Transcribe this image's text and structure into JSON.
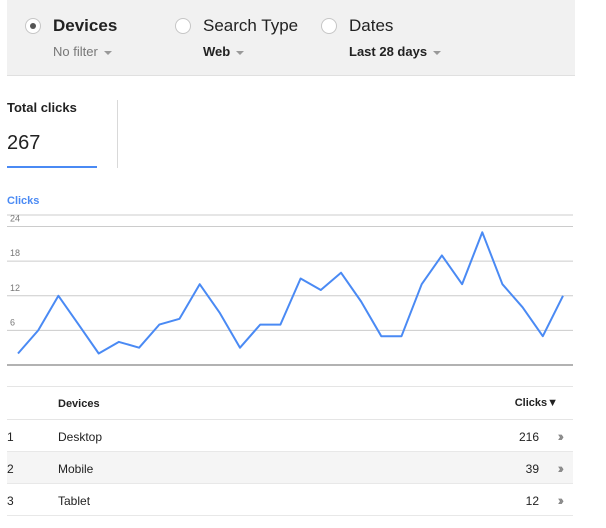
{
  "filters": [
    {
      "label": "Devices",
      "value": "No filter",
      "selected": true
    },
    {
      "label": "Search Type",
      "value": "Web",
      "selected": false
    },
    {
      "label": "Dates",
      "value": "Last 28 days",
      "selected": false
    }
  ],
  "metric": {
    "label": "Total clicks",
    "value": "267"
  },
  "chart_data": {
    "type": "line",
    "title": "Clicks",
    "xlabel": "",
    "ylabel": "",
    "ylim": [
      0,
      26
    ],
    "yticks": [
      "6",
      "12",
      "18",
      "24"
    ],
    "grid": true,
    "series": [
      {
        "values": [
          2,
          6,
          12,
          7,
          2,
          4,
          3,
          7,
          8,
          14,
          9,
          3,
          7,
          7,
          15,
          13,
          16,
          11,
          5,
          5,
          14,
          19,
          14,
          23,
          14,
          10,
          5,
          12
        ]
      }
    ],
    "colors": {
      "line": "#4a8af4",
      "grid": "#cccccc",
      "axis": "#666666"
    }
  },
  "table": {
    "header_devices": "Devices",
    "header_clicks": "Clicks▼",
    "rows": [
      {
        "idx": "1",
        "name": "Desktop",
        "value": "216"
      },
      {
        "idx": "2",
        "name": "Mobile",
        "value": "39"
      },
      {
        "idx": "3",
        "name": "Tablet",
        "value": "12"
      }
    ]
  }
}
